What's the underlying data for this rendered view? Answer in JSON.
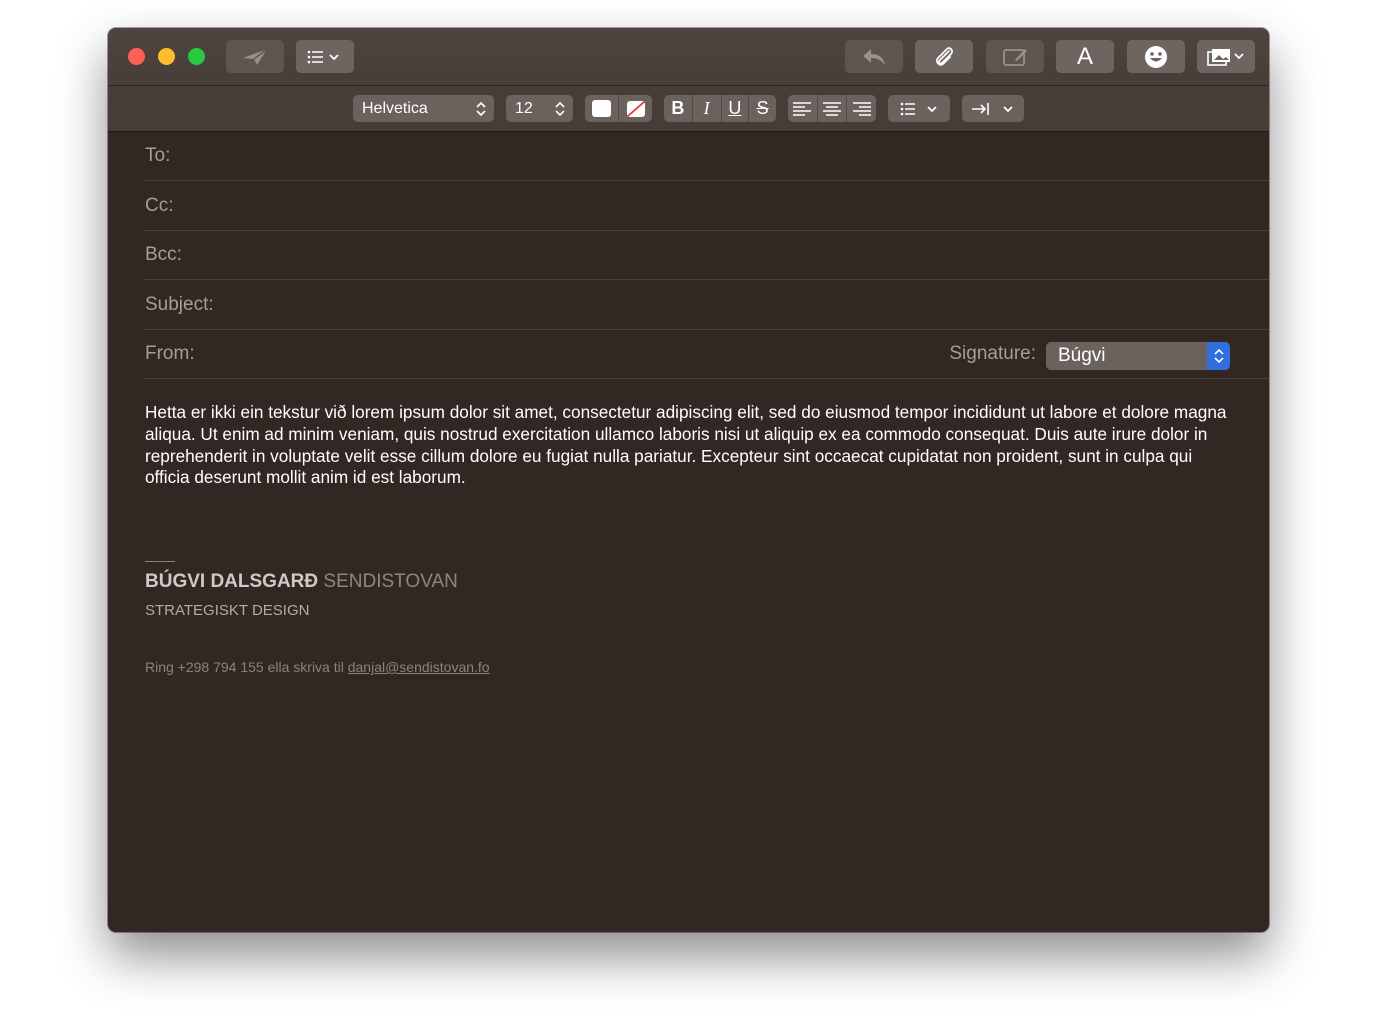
{
  "window": {
    "toolbar": {
      "send_icon": "paper-plane-icon",
      "header_fields_icon": "list-icon",
      "reply_icon": "reply-arrow-icon",
      "attach_icon": "paperclip-icon",
      "markup_icon": "markup-icon",
      "fonts_label": "A",
      "emoji_icon": "smiley-icon",
      "photo_icon": "photo-browser-icon"
    },
    "format_bar": {
      "font_family": "Helvetica",
      "font_size": "12",
      "bold": "B",
      "italic": "I",
      "underline": "U",
      "strikethrough": "S"
    },
    "headers": {
      "to_label": "To:",
      "cc_label": "Cc:",
      "bcc_label": "Bcc:",
      "subject_label": "Subject:",
      "from_label": "From:",
      "signature_label": "Signature:",
      "signature_value": "Búgvi"
    },
    "body": {
      "text": "Hetta er ikki ein tekstur við lorem ipsum dolor sit amet, consectetur adipiscing elit, sed do eiusmod tempor incididunt ut labore et dolore magna aliqua. Ut enim ad minim veniam, quis nostrud exercitation ullamco laboris nisi ut aliquip ex ea commodo consequat. Duis aute irure dolor in reprehenderit in voluptate velit esse cillum dolore eu fugiat nulla pariatur. Excepteur sint occaecat cupidatat non proident, sunt in culpa qui officia deserunt mollit anim id est laborum."
    },
    "signature": {
      "name": "BÚGVI DALSGARÐ",
      "company": "SENDISTOVAN",
      "tagline": "STRATEGISKT DESIGN",
      "contact_prefix": "Ring +298 794 155 ella skriva til",
      "email": "danjal@sendistovan.fo"
    },
    "colors": {
      "window_bg": "#322723",
      "titlebar_bg": "#4e4440",
      "close": "#fe5f57",
      "minimize": "#febc2e",
      "zoom": "#29c840",
      "accent": "#2f6fe0"
    }
  }
}
